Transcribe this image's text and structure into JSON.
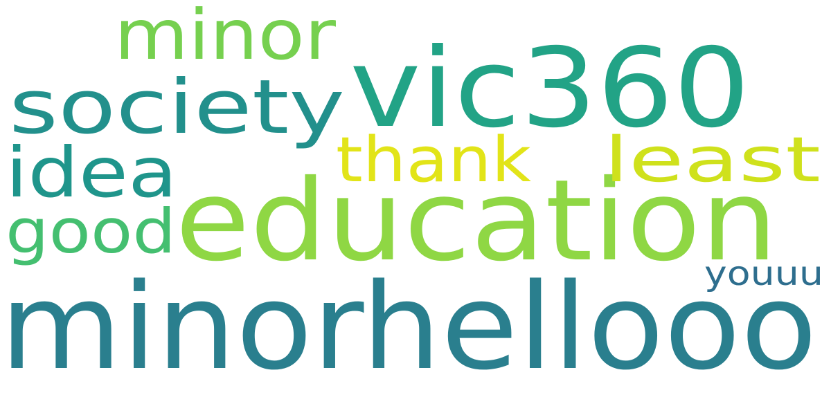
{
  "words": [
    {
      "id": "minorhellooo",
      "text": "minorhellooo",
      "color": "#2a7f8e"
    },
    {
      "id": "education",
      "text": "education",
      "color": "#8fd744"
    },
    {
      "id": "vic360",
      "text": "vic360",
      "color": "#22a386"
    },
    {
      "id": "society",
      "text": "society",
      "color": "#22908c"
    },
    {
      "id": "minor",
      "text": "minor",
      "color": "#76d04f"
    },
    {
      "id": "idea",
      "text": "idea",
      "color": "#1f958b"
    },
    {
      "id": "good",
      "text": "good",
      "color": "#44bf70"
    },
    {
      "id": "thank",
      "text": "thank",
      "color": "#e2e418"
    },
    {
      "id": "least",
      "text": "least",
      "color": "#cfe11c"
    },
    {
      "id": "youuu",
      "text": "youuu",
      "color": "#2e6e8e"
    }
  ]
}
